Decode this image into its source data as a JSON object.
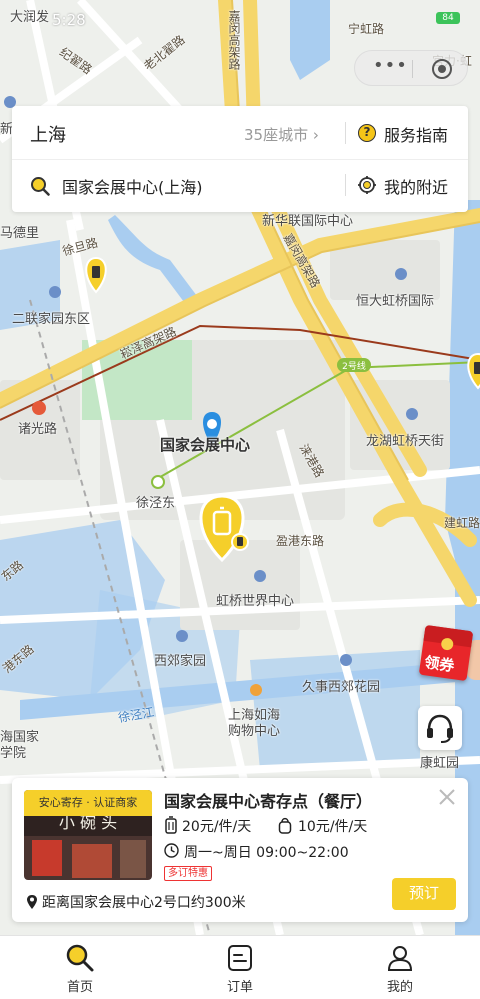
{
  "status": {
    "time": "5:28",
    "battery": "84"
  },
  "search": {
    "city": "上海",
    "city_count": "35座城市",
    "guide_label": "服务指南",
    "query": "国家会展中心(上海)",
    "nearby_label": "我的附近"
  },
  "map": {
    "labels": {
      "dadunfa": "大润发",
      "jizhai_road": "纪翟路",
      "laobei_road": "老北翟路",
      "jiagang_viaduct": "嘉闵高架路",
      "ninghong_road": "宁虹路",
      "gongli_hong": "宫力·虹",
      "xin": "新",
      "maide": "马德里",
      "xuhui_road": "徐旦路",
      "xinhualian": "新华联国际中心",
      "ninghong_v": "嘉闵高架路",
      "hengda": "恒大虹桥国际",
      "erlian": "二联家园东区",
      "songze_viaduct": "崧泽高架路",
      "zhuguang_road": "诸光路",
      "line2": "2号线",
      "nec": "国家会展中心",
      "longhu": "龙湖虹桥天街",
      "zhugang_road": "涞港路",
      "xujingdong": "徐泾东",
      "jiangong_road": "建虹路",
      "yingang_east": "盈港东路",
      "dong_road": "东路",
      "hongqiao_world": "虹桥世界中心",
      "xijiao": "西郊家园",
      "gang_east": "港东路",
      "jiushi": "久事西郊花园",
      "xujing_river": "徐泾江",
      "rhmall_1": "上海如海",
      "rhmall_2": "购物中心",
      "guojia_1": "海国家",
      "guojia_2": "学院",
      "kanghong": "康虹园"
    }
  },
  "coupon": {
    "label": "领券"
  },
  "store": {
    "badge": "安心寄存 · 认证商家",
    "photo_sign": "小 碗 头",
    "name": "国家会展中心寄存点（餐厅）",
    "price_large": "20元/件/天",
    "price_small": "10元/件/天",
    "hours": "周一~周日 09:00~22:00",
    "promo": "多订特惠",
    "book_label": "预订",
    "distance": "距离国家会展中心2号口约300米"
  },
  "tabs": [
    {
      "label": "首页",
      "icon": "search-icon"
    },
    {
      "label": "订单",
      "icon": "order-icon"
    },
    {
      "label": "我的",
      "icon": "profile-icon"
    }
  ],
  "colors": {
    "accent": "#f5cf2a",
    "water": "#a9cdf0",
    "highway": "#f5d66b",
    "metro_line2": "#8bbf3f",
    "rail": "#9a3a1c"
  }
}
